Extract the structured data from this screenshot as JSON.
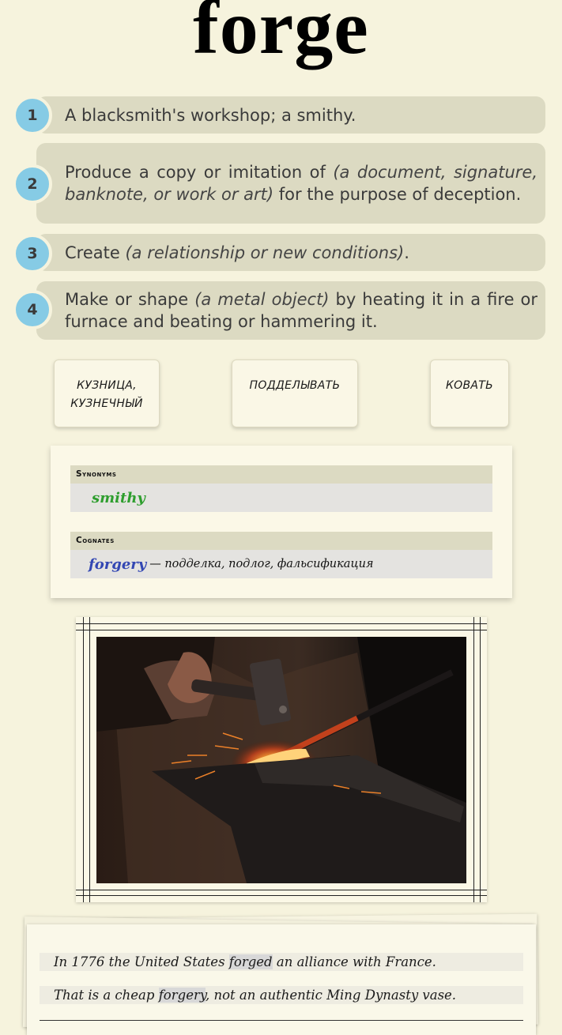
{
  "word": "forge",
  "definitions": [
    {
      "number": "1",
      "text": "A blacksmith's workshop; a smithy."
    },
    {
      "number": "2",
      "pre": "Produce a copy or imitation of ",
      "ital": "(a document, signature, banknote, or work or art)",
      "post": " for the purpose of decep­tion."
    },
    {
      "number": "3",
      "pre": "Create ",
      "ital": "(a relationship or new conditions)",
      "post": "."
    },
    {
      "number": "4",
      "pre": "Make or shape ",
      "ital": "(a metal object)",
      "post": " by heating it in a fire or furnace and beating or hammering it."
    }
  ],
  "translations": [
    {
      "line1": "КУЗНИЦА,",
      "line2": "КУЗНЕЧНЫЙ"
    },
    {
      "line1": "ПОДДЕЛЫВАТЬ",
      "line2": ""
    },
    {
      "line1": "КОВАТЬ",
      "line2": ""
    }
  ],
  "synonyms": {
    "heading": "Synonyms",
    "word": "smithy"
  },
  "cognates": {
    "heading": "Cognates",
    "word": "forgery",
    "translation": "— подделка, подлог, фальсификация"
  },
  "image": {
    "icon": "blacksmith-hammering-photo"
  },
  "examples": [
    {
      "before": "In 1776 the United States ",
      "highlight": "forged",
      "after": " an alliance with France."
    },
    {
      "before": "That is a cheap ",
      "highlight": "forgery",
      "after": ", not an authentic Ming Dynasty vase."
    }
  ]
}
